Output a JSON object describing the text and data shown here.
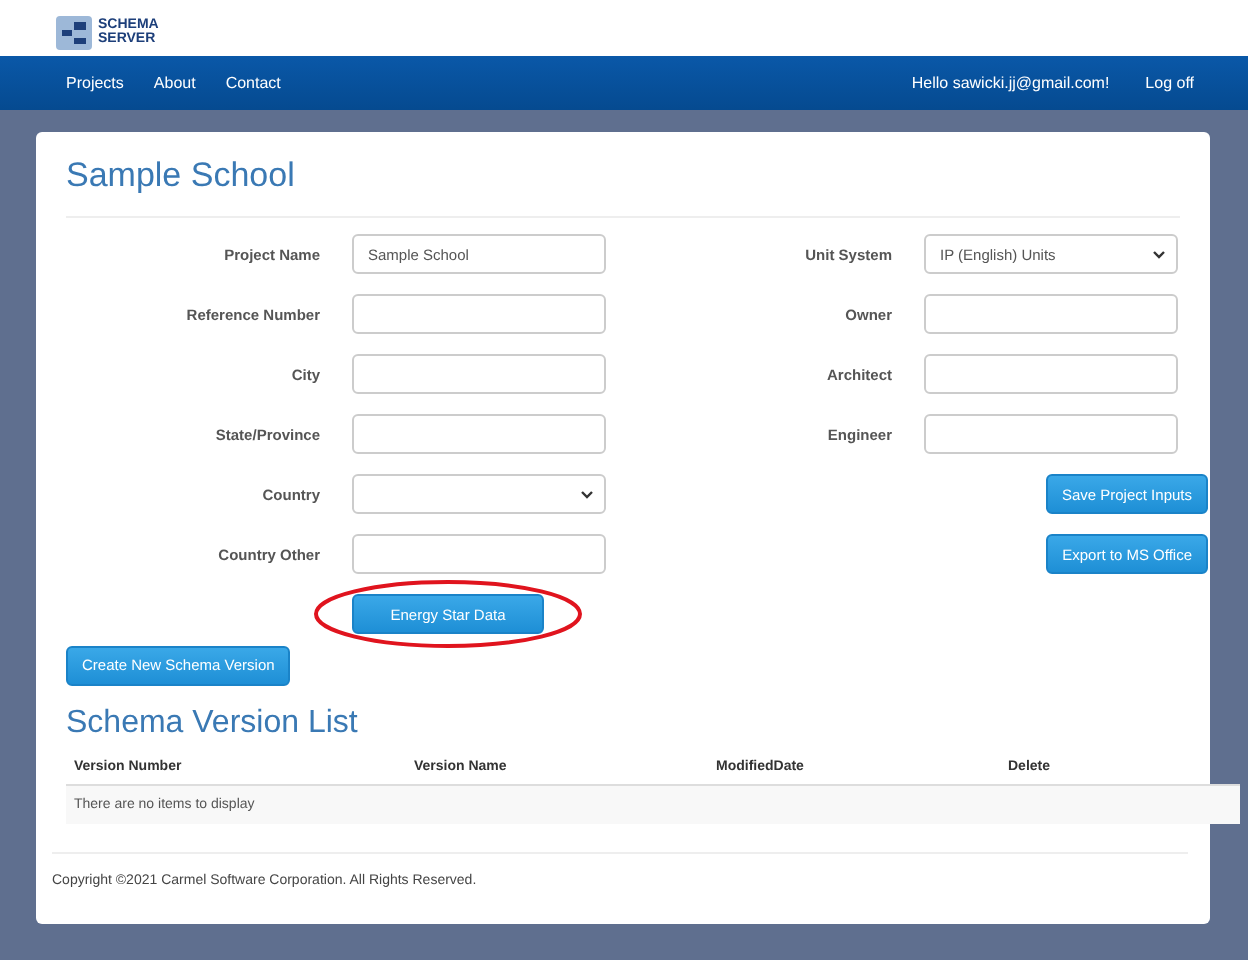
{
  "logo": {
    "line_1": "SCHEMA",
    "line_2": "SERVER"
  },
  "nav": {
    "links": [
      "Projects",
      "About",
      "Contact"
    ],
    "greeting": "Hello sawicki.jj@gmail.com!",
    "logoff": "Log off"
  },
  "project": {
    "title": "Sample School",
    "left_fields": [
      {
        "label": "Project Name",
        "kind": "text",
        "value": "Sample School"
      },
      {
        "label": "Reference Number",
        "kind": "text"
      },
      {
        "label": "City",
        "kind": "text"
      },
      {
        "label": "State/Province",
        "kind": "text"
      },
      {
        "label": "Country",
        "kind": "select"
      },
      {
        "label": "Country Other",
        "kind": "text"
      }
    ],
    "right_fields": [
      {
        "label": "Unit System",
        "kind": "select",
        "value": "IP (English) Units"
      },
      {
        "label": "Owner",
        "kind": "text"
      },
      {
        "label": "Architect",
        "kind": "text"
      },
      {
        "label": "Engineer",
        "kind": "text"
      }
    ],
    "right_buttons": [
      "Save Project Inputs",
      "Export to MS Office"
    ],
    "energy_button": {
      "label": "Energy Star Data",
      "highlighted": true
    },
    "create_button": "Create New Schema Version"
  },
  "versions": {
    "title": "Schema Version List",
    "columns": [
      "Version Number",
      "Version Name",
      "ModifiedDate",
      "Delete"
    ],
    "empty_message": "There are no items to display"
  },
  "footer": "Copyright ©2021 Carmel Software Corporation. All Rights Reserved."
}
